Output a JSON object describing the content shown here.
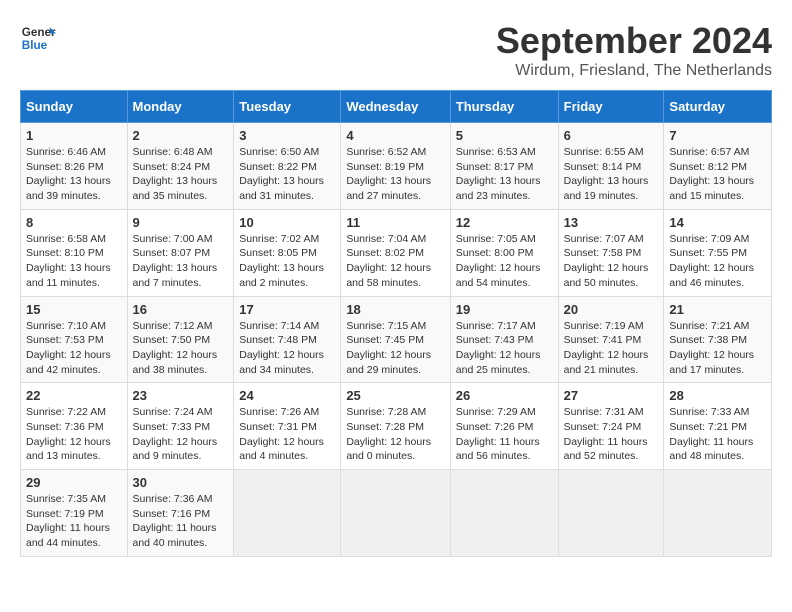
{
  "header": {
    "logo_line1": "General",
    "logo_line2": "Blue",
    "month": "September 2024",
    "location": "Wirdum, Friesland, The Netherlands"
  },
  "weekdays": [
    "Sunday",
    "Monday",
    "Tuesday",
    "Wednesday",
    "Thursday",
    "Friday",
    "Saturday"
  ],
  "weeks": [
    [
      {
        "day": "1",
        "sunrise": "Sunrise: 6:46 AM",
        "sunset": "Sunset: 8:26 PM",
        "daylight": "Daylight: 13 hours and 39 minutes."
      },
      {
        "day": "2",
        "sunrise": "Sunrise: 6:48 AM",
        "sunset": "Sunset: 8:24 PM",
        "daylight": "Daylight: 13 hours and 35 minutes."
      },
      {
        "day": "3",
        "sunrise": "Sunrise: 6:50 AM",
        "sunset": "Sunset: 8:22 PM",
        "daylight": "Daylight: 13 hours and 31 minutes."
      },
      {
        "day": "4",
        "sunrise": "Sunrise: 6:52 AM",
        "sunset": "Sunset: 8:19 PM",
        "daylight": "Daylight: 13 hours and 27 minutes."
      },
      {
        "day": "5",
        "sunrise": "Sunrise: 6:53 AM",
        "sunset": "Sunset: 8:17 PM",
        "daylight": "Daylight: 13 hours and 23 minutes."
      },
      {
        "day": "6",
        "sunrise": "Sunrise: 6:55 AM",
        "sunset": "Sunset: 8:14 PM",
        "daylight": "Daylight: 13 hours and 19 minutes."
      },
      {
        "day": "7",
        "sunrise": "Sunrise: 6:57 AM",
        "sunset": "Sunset: 8:12 PM",
        "daylight": "Daylight: 13 hours and 15 minutes."
      }
    ],
    [
      {
        "day": "8",
        "sunrise": "Sunrise: 6:58 AM",
        "sunset": "Sunset: 8:10 PM",
        "daylight": "Daylight: 13 hours and 11 minutes."
      },
      {
        "day": "9",
        "sunrise": "Sunrise: 7:00 AM",
        "sunset": "Sunset: 8:07 PM",
        "daylight": "Daylight: 13 hours and 7 minutes."
      },
      {
        "day": "10",
        "sunrise": "Sunrise: 7:02 AM",
        "sunset": "Sunset: 8:05 PM",
        "daylight": "Daylight: 13 hours and 2 minutes."
      },
      {
        "day": "11",
        "sunrise": "Sunrise: 7:04 AM",
        "sunset": "Sunset: 8:02 PM",
        "daylight": "Daylight: 12 hours and 58 minutes."
      },
      {
        "day": "12",
        "sunrise": "Sunrise: 7:05 AM",
        "sunset": "Sunset: 8:00 PM",
        "daylight": "Daylight: 12 hours and 54 minutes."
      },
      {
        "day": "13",
        "sunrise": "Sunrise: 7:07 AM",
        "sunset": "Sunset: 7:58 PM",
        "daylight": "Daylight: 12 hours and 50 minutes."
      },
      {
        "day": "14",
        "sunrise": "Sunrise: 7:09 AM",
        "sunset": "Sunset: 7:55 PM",
        "daylight": "Daylight: 12 hours and 46 minutes."
      }
    ],
    [
      {
        "day": "15",
        "sunrise": "Sunrise: 7:10 AM",
        "sunset": "Sunset: 7:53 PM",
        "daylight": "Daylight: 12 hours and 42 minutes."
      },
      {
        "day": "16",
        "sunrise": "Sunrise: 7:12 AM",
        "sunset": "Sunset: 7:50 PM",
        "daylight": "Daylight: 12 hours and 38 minutes."
      },
      {
        "day": "17",
        "sunrise": "Sunrise: 7:14 AM",
        "sunset": "Sunset: 7:48 PM",
        "daylight": "Daylight: 12 hours and 34 minutes."
      },
      {
        "day": "18",
        "sunrise": "Sunrise: 7:15 AM",
        "sunset": "Sunset: 7:45 PM",
        "daylight": "Daylight: 12 hours and 29 minutes."
      },
      {
        "day": "19",
        "sunrise": "Sunrise: 7:17 AM",
        "sunset": "Sunset: 7:43 PM",
        "daylight": "Daylight: 12 hours and 25 minutes."
      },
      {
        "day": "20",
        "sunrise": "Sunrise: 7:19 AM",
        "sunset": "Sunset: 7:41 PM",
        "daylight": "Daylight: 12 hours and 21 minutes."
      },
      {
        "day": "21",
        "sunrise": "Sunrise: 7:21 AM",
        "sunset": "Sunset: 7:38 PM",
        "daylight": "Daylight: 12 hours and 17 minutes."
      }
    ],
    [
      {
        "day": "22",
        "sunrise": "Sunrise: 7:22 AM",
        "sunset": "Sunset: 7:36 PM",
        "daylight": "Daylight: 12 hours and 13 minutes."
      },
      {
        "day": "23",
        "sunrise": "Sunrise: 7:24 AM",
        "sunset": "Sunset: 7:33 PM",
        "daylight": "Daylight: 12 hours and 9 minutes."
      },
      {
        "day": "24",
        "sunrise": "Sunrise: 7:26 AM",
        "sunset": "Sunset: 7:31 PM",
        "daylight": "Daylight: 12 hours and 4 minutes."
      },
      {
        "day": "25",
        "sunrise": "Sunrise: 7:28 AM",
        "sunset": "Sunset: 7:28 PM",
        "daylight": "Daylight: 12 hours and 0 minutes."
      },
      {
        "day": "26",
        "sunrise": "Sunrise: 7:29 AM",
        "sunset": "Sunset: 7:26 PM",
        "daylight": "Daylight: 11 hours and 56 minutes."
      },
      {
        "day": "27",
        "sunrise": "Sunrise: 7:31 AM",
        "sunset": "Sunset: 7:24 PM",
        "daylight": "Daylight: 11 hours and 52 minutes."
      },
      {
        "day": "28",
        "sunrise": "Sunrise: 7:33 AM",
        "sunset": "Sunset: 7:21 PM",
        "daylight": "Daylight: 11 hours and 48 minutes."
      }
    ],
    [
      {
        "day": "29",
        "sunrise": "Sunrise: 7:35 AM",
        "sunset": "Sunset: 7:19 PM",
        "daylight": "Daylight: 11 hours and 44 minutes."
      },
      {
        "day": "30",
        "sunrise": "Sunrise: 7:36 AM",
        "sunset": "Sunset: 7:16 PM",
        "daylight": "Daylight: 11 hours and 40 minutes."
      },
      null,
      null,
      null,
      null,
      null
    ]
  ]
}
